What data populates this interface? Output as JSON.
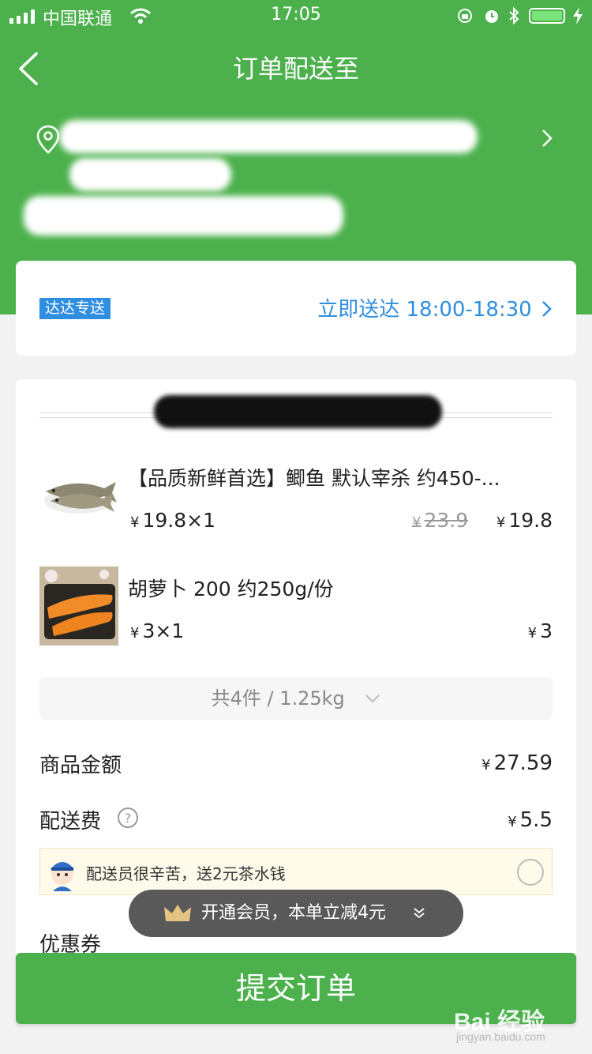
{
  "status_bar": {
    "carrier": "中国联通",
    "time": "17:05"
  },
  "header": {
    "title": "订单配送至"
  },
  "delivery": {
    "badge": "达达专送",
    "time": "立即送达 18:00-18:30"
  },
  "items": [
    {
      "name": "【品质新鲜首选】鲫鱼 默认宰杀 约450-...",
      "unit_price": "19.8×1",
      "original_price": "23.9",
      "price": "19.8"
    },
    {
      "name": "胡萝卜 200 约250g/份",
      "unit_price": "3×1",
      "price": "3"
    }
  ],
  "summary": {
    "text": "共4件 / 1.25kg"
  },
  "fees": {
    "goods_label": "商品金额",
    "goods_value": "27.59",
    "delivery_label": "配送费",
    "delivery_value": "5.5",
    "tip_text": "配送员很辛苦，送2元茶水钱",
    "coupon_label": "优惠券"
  },
  "member_banner": {
    "text": "开通会员，本单立减4元"
  },
  "submit": {
    "label": "提交订单"
  },
  "currency": "¥",
  "watermark": {
    "logo": "Bai 经验",
    "url": "jingyan.baidu.com"
  },
  "colors": {
    "brand_green": "#4cb14d",
    "link_blue": "#2f8ee0"
  }
}
